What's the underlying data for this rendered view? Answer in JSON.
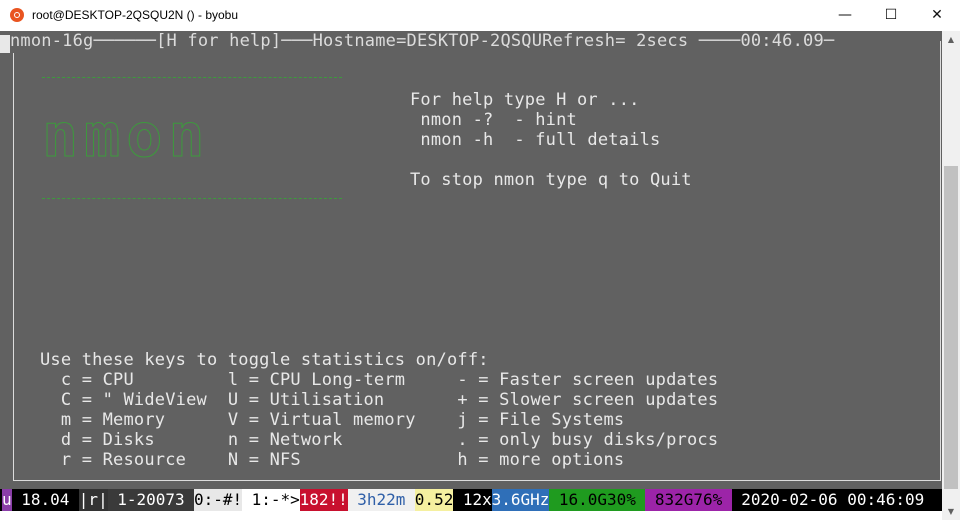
{
  "window": {
    "title": "root@DESKTOP-2QSQU2N () - byobu",
    "app_icon": "ubuntu-icon",
    "controls": {
      "minimize": "—",
      "maximize": "☐",
      "close": "✕"
    }
  },
  "terminal": {
    "header": "nmon-16g──────[H for help]───Hostname=DESKTOP-2QSQURefresh= 2secs ────00:46.09─",
    "logo_text": "nmon",
    "help_lines": [
      "For help type H or ...",
      " nmon -?  - hint",
      " nmon -h  - full details",
      "",
      "To stop nmon type q to Quit"
    ],
    "keys_title": "Use these keys to toggle statistics on/off:",
    "key_lines": [
      "  c = CPU         l = CPU Long-term     - = Faster screen updates",
      "  C = \" WideView  U = Utilisation       + = Slower screen updates",
      "  m = Memory      V = Virtual memory    j = File Systems",
      "  d = Disks       n = Network           . = only busy disks/procs",
      "  r = Resource    N = NFS               h = more options"
    ]
  },
  "statusbar": {
    "segments": [
      {
        "text": "u",
        "fg": "#ffffff",
        "bg": "#8a3ea8"
      },
      {
        "text": " 18.04 ",
        "fg": "#ffffff",
        "bg": "#000000"
      },
      {
        "text": "|r|",
        "fg": "#ffffff",
        "bg": "#333333"
      },
      {
        "text": " 1-20073 ",
        "fg": "#ffffff",
        "bg": "#3a3a3a"
      },
      {
        "text": "0:-#!",
        "fg": "#000000",
        "bg": "#e8e8e8"
      },
      {
        "text": " 1:-*>",
        "fg": "#000000",
        "bg": "#ffffff"
      },
      {
        "text": "182!!",
        "fg": "#ffffff",
        "bg": "#c8102e"
      },
      {
        "text": " 3h22m ",
        "fg": "#2f5fa8",
        "bg": "#f0f0f0"
      },
      {
        "text": "0.52",
        "fg": "#000000",
        "bg": "#f5f0a0"
      },
      {
        "text": " 12x",
        "fg": "#ffffff",
        "bg": "#000000"
      },
      {
        "text": "3.6GHz",
        "fg": "#ffffff",
        "bg": "#2f6fb8"
      },
      {
        "text": " 16.0G30% ",
        "fg": "#000000",
        "bg": "#1f9b1f"
      },
      {
        "text": " 832G76% ",
        "fg": "#000000",
        "bg": "#9c24a8"
      },
      {
        "text": " 2020-02-06 00:46:09",
        "fg": "#ffffff",
        "bg": "#000000"
      }
    ]
  },
  "scrollbar": {
    "up_icon": "▲",
    "down_icon": "▼"
  }
}
